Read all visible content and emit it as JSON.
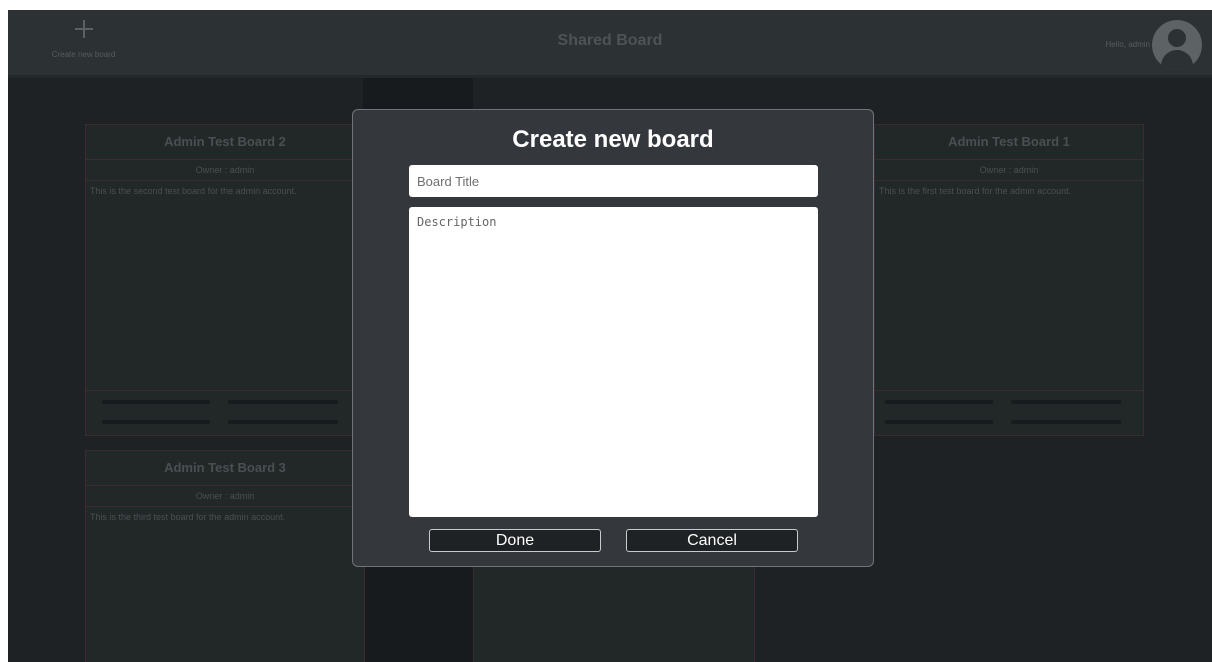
{
  "header": {
    "create_label": "Create new board",
    "page_title": "Shared Board",
    "greeting": "Hello, admin"
  },
  "boards": [
    {
      "title": "Admin Test Board 2",
      "owner": "Owner : admin",
      "description": "This is the second test board for the admin account."
    },
    {
      "title": "Admin Test Board 1",
      "owner": "Owner : admin",
      "description": "This is the first test board for the admin account."
    },
    {
      "title": "Admin Test Board 3",
      "owner": "Owner : admin",
      "description": "This is the third test board for the admin account."
    }
  ],
  "modal": {
    "title": "Create new board",
    "title_placeholder": "Board Title",
    "title_value": "",
    "description_placeholder": "Description",
    "description_value": "",
    "done_label": "Done",
    "cancel_label": "Cancel"
  }
}
